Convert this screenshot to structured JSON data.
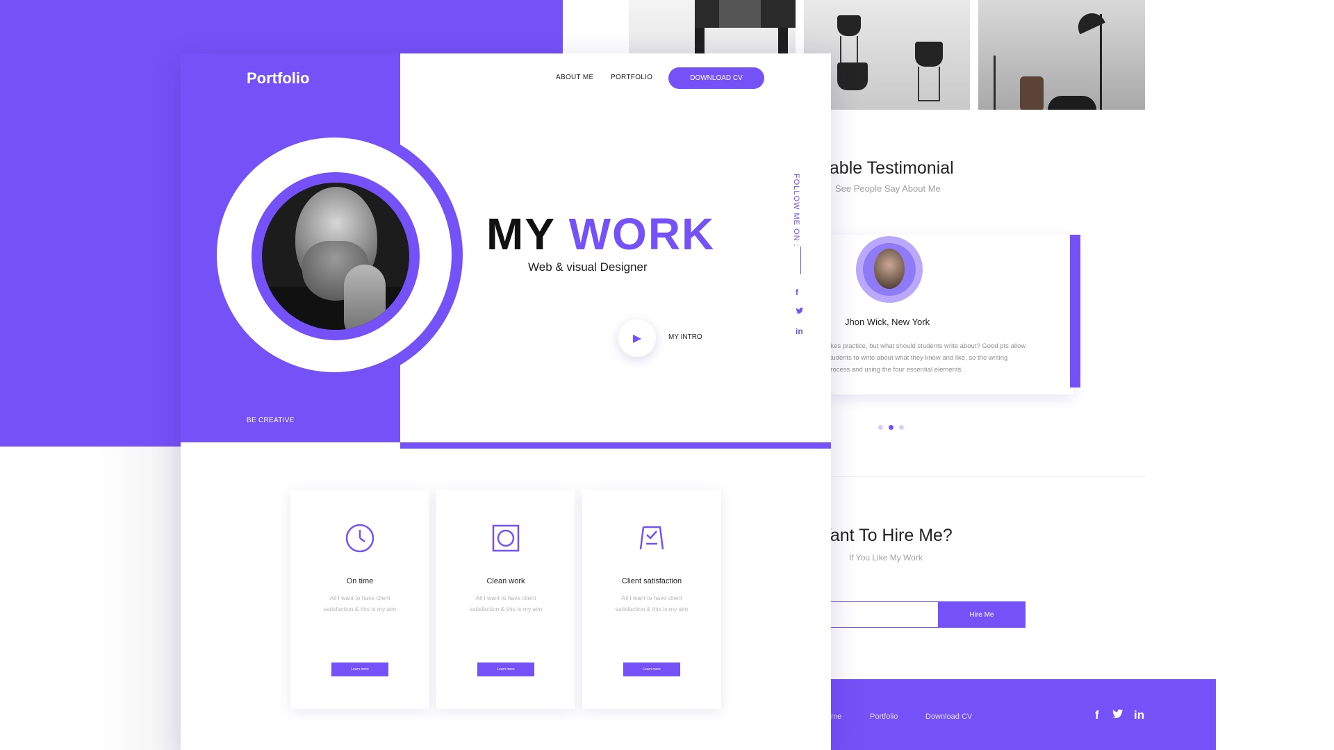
{
  "colors": {
    "accent": "#7452f7",
    "text": "#222222",
    "muted": "#a0a0a0"
  },
  "front": {
    "logo": "Portfolio",
    "nav": {
      "about": "ABOUT ME",
      "portfolio": "PORTFOLIO",
      "download": "DOWNLOAD CV"
    },
    "hero": {
      "title_part1": "MY ",
      "title_part2": "WORK",
      "subtitle": "Web & visual Designer",
      "intro": "MY INTRO"
    },
    "tagline": "BE CREATIVE",
    "follow": "FOLLOW ME ON :",
    "social_icons": [
      "facebook-icon",
      "twitter-icon",
      "linkedin-icon"
    ],
    "social_glyphs": [
      "f",
      "t",
      "in"
    ],
    "features": [
      {
        "icon": "clock-icon",
        "title": "On time",
        "text": "All I want to have client satisfaction & this is my aim",
        "button": "Learn more"
      },
      {
        "icon": "square-target-icon",
        "title": "Clean work",
        "text": "All I want to have client satisfaction & this is my aim",
        "button": "Learn more"
      },
      {
        "icon": "easel-check-icon",
        "title": "Client satisfaction",
        "text": "All I want to have client satisfaction & this is my aim",
        "button": "Learn more"
      }
    ]
  },
  "back": {
    "testimonial": {
      "title": "uable Testimonial",
      "subtitle": "See People Say About Me",
      "name": "Jhon Wick, New York",
      "text": "akes practice, but what should students write about? Good pts allow students to write about what they know and like, so the writing process and using the four essential elements."
    },
    "hire": {
      "title": "Vant To Hire Me?",
      "subtitle": "If You Like My Work",
      "button": "Hire Me"
    },
    "footer": {
      "links": [
        "me",
        "Portfolio",
        "Download CV"
      ],
      "icons": [
        "facebook-icon",
        "twitter-icon",
        "linkedin-icon"
      ],
      "glyphs": [
        "f",
        "t",
        "in"
      ]
    }
  }
}
